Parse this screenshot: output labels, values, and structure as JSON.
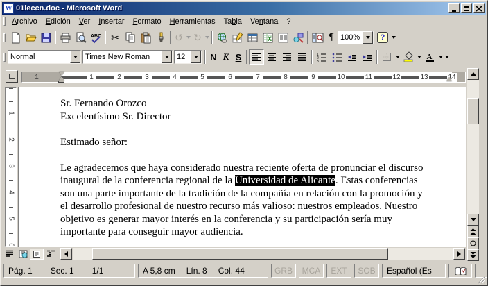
{
  "window": {
    "title": "01leccn.doc - Microsoft Word"
  },
  "icons": {
    "word_mark": "W",
    "cut": "✂",
    "undo": "↺",
    "redo": "↻",
    "pilcrow": "¶",
    "help": "?"
  },
  "menu": [
    {
      "pre": "",
      "key": "A",
      "post": "rchivo"
    },
    {
      "pre": "",
      "key": "E",
      "post": "dición"
    },
    {
      "pre": "",
      "key": "V",
      "post": "er"
    },
    {
      "pre": "",
      "key": "I",
      "post": "nsertar"
    },
    {
      "pre": "",
      "key": "F",
      "post": "ormato"
    },
    {
      "pre": "",
      "key": "H",
      "post": "erramientas"
    },
    {
      "pre": "Ta",
      "key": "b",
      "post": "la"
    },
    {
      "pre": "Ve",
      "key": "n",
      "post": "tana"
    },
    {
      "pre": "?",
      "key": "",
      "post": ""
    }
  ],
  "toolbar_std": {
    "zoom_value": "100%"
  },
  "toolbar_fmt": {
    "style": "Normal",
    "font": "Times New Roman",
    "size": "12",
    "bold_label": "N",
    "italic_label": "K",
    "underline_label": "S"
  },
  "ruler": {
    "h_margin_number": "1",
    "h_numbers": [
      "1",
      "2",
      "3",
      "4",
      "5",
      "6",
      "7",
      "8",
      "9",
      "10",
      "11",
      "12",
      "13",
      "14"
    ],
    "v_numbers": [
      "1",
      "2",
      "3",
      "4",
      "5",
      "6"
    ]
  },
  "document": {
    "recipient_line1": "Sr. Fernando Orozco",
    "recipient_line2": "Excelentísimo Sr. Director",
    "salutation": "Estimado señor:",
    "para": {
      "l1": "Le agradecemos que haya considerado nuestra reciente oferta de pronunciar el discurso",
      "l2_pre": "inaugural de la conferencia regional de la ",
      "l2_sel": "Universidad de Alicante",
      "l2_post": ". Estas conferencias",
      "l3": "son una parte importante de la tradición de la compañía en relación con la promoción y",
      "l4": "el desarrollo profesional de nuestro recurso más valioso: nuestros empleados. Nuestro",
      "l5": "objetivo es generar mayor interés en la conferencia y su participación sería muy",
      "l6": "importante para conseguir mayor audiencia."
    }
  },
  "status": {
    "page": "Pág. 1",
    "section": "Sec. 1",
    "page_of": "1/1",
    "at": "A 5,8 cm",
    "line": "Lín. 8",
    "col": "Col. 44",
    "grb": "GRB",
    "mca": "MCA",
    "ext": "EXT",
    "sob": "SOB",
    "language": "Español (Es"
  },
  "colors": {
    "title_gradient_start": "#0a246a",
    "title_gradient_end": "#a6caf0",
    "window_face": "#d4d0c8",
    "selection_bg": "#000000",
    "highlight_yellow": "#ffff00"
  }
}
